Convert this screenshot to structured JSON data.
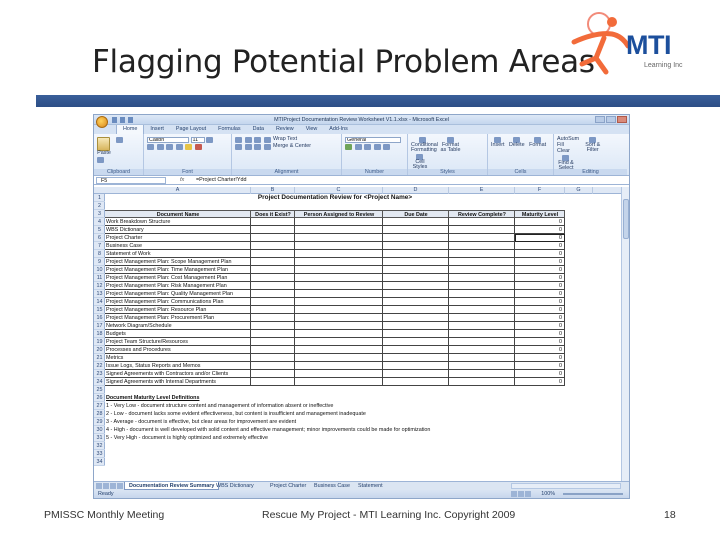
{
  "slide": {
    "title": "Flagging Potential Problem Areas",
    "logo_text": "MTI",
    "logo_sub": "Learning Inc",
    "footer_left": "PMISSC Monthly Meeting",
    "footer_center": "Rescue My Project - MTI Learning Inc. Copyright 2009",
    "page_number": "18"
  },
  "excel": {
    "window_title": "MTIProject Documentation Review Worksheet V1.1.xlsx - Microsoft Excel",
    "tabs": [
      "Home",
      "Insert",
      "Page Layout",
      "Formulas",
      "Data",
      "Review",
      "View",
      "Add-Ins"
    ],
    "ribbon": {
      "paste": "Paste",
      "font_name": "Calibri",
      "font_size": "11",
      "wrap_text": "Wrap Text",
      "merge_center": "Merge & Center",
      "number_format": "General",
      "conditional_formatting": "Conditional Formatting",
      "format_as_table": "Format as Table",
      "cell_styles": "Cell Styles",
      "insert": "Insert",
      "delete": "Delete",
      "format": "Format",
      "autosum": "AutoSum",
      "fill": "Fill",
      "clear": "Clear",
      "sort_filter": "Sort & Filter",
      "find_select": "Find & Select",
      "groups": [
        "Clipboard",
        "Font",
        "Alignment",
        "Number",
        "Styles",
        "Cells",
        "Editing"
      ]
    },
    "name_box": "F5",
    "formula_prefix": "fx",
    "formula": "=Project Charter!Ydd",
    "columns": [
      "A",
      "B",
      "C",
      "D",
      "E",
      "F",
      "G"
    ],
    "sheet_title": "Project Documentation Review for <Project Name>",
    "table_headers": [
      "Document Name",
      "Does it Exist?",
      "Person Assigned to Review",
      "Due Date",
      "Review Complete?",
      "Maturity Level"
    ],
    "documents": [
      "Work Breakdown Structure",
      "WBS Dictionary",
      "Project Charter",
      "Business Case",
      "Statement of Work",
      "Project Management Plan: Scope Management Plan",
      "Project Management Plan: Time Management Plan",
      "Project Management Plan: Cost Management Plan",
      "Project Management Plan: Risk Management Plan",
      "Project Management Plan: Quality Management Plan",
      "Project Management Plan: Communications Plan",
      "Project Management Plan: Resource Plan",
      "Project Management Plan: Procurement Plan",
      "Network Diagram/Schedule",
      "Budgets",
      "Project Team Structure/Resources",
      "Processes and Procedures",
      "Metrics",
      "Issue Logs, Status Reports and Memos",
      "Signed Agreements with Contractors and/or Clients",
      "Signed Agreements with Internal Departments"
    ],
    "maturity_values": [
      "0",
      "0",
      "0",
      "0",
      "0",
      "0",
      "0",
      "0",
      "0",
      "0",
      "0",
      "0",
      "0",
      "0",
      "0",
      "0",
      "0",
      "0",
      "0",
      "0",
      "0"
    ],
    "definitions_title": "Document Maturity Level Definitions",
    "definitions": [
      "1 - Very Low - document structure content and management of information absent or ineffective",
      "2 - Low - document lacks some evident effectiveness, but content is insufficient and management inadequate",
      "3 - Average - document is effective, but clear areas for improvement are evident",
      "4 - High - document is well developed with solid content and effective management; minor improvements could be made for optimization",
      "5 - Very High - document is highly optimized and extremely effective"
    ],
    "row_numbers": [
      "1",
      "2",
      "3",
      "4",
      "5",
      "6",
      "7",
      "8",
      "9",
      "10",
      "11",
      "12",
      "13",
      "14",
      "15",
      "16",
      "17",
      "18",
      "19",
      "20",
      "21",
      "22",
      "23",
      "24",
      "25",
      "26",
      "27",
      "28",
      "29",
      "30",
      "31",
      "32",
      "33",
      "34"
    ],
    "sheet_tabs": [
      "Documentation Review Summary",
      "WBS Dictionary",
      "Project Charter",
      "Business Case",
      "Statement"
    ],
    "status": "Ready",
    "zoom": "100%"
  }
}
